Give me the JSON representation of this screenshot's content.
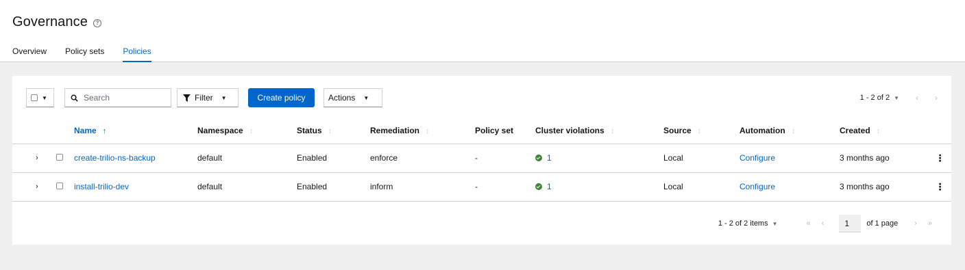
{
  "header": {
    "title": "Governance",
    "help_icon": "help-icon",
    "tabs": [
      {
        "label": "Overview",
        "active": false
      },
      {
        "label": "Policy sets",
        "active": false
      },
      {
        "label": "Policies",
        "active": true
      }
    ]
  },
  "toolbar": {
    "search_placeholder": "Search",
    "filter_label": "Filter",
    "create_label": "Create policy",
    "actions_label": "Actions",
    "pagination_label": "1 - 2 of 2"
  },
  "table": {
    "columns": [
      "Name",
      "Namespace",
      "Status",
      "Remediation",
      "Policy set",
      "Cluster violations",
      "Source",
      "Automation",
      "Created"
    ],
    "rows": [
      {
        "name": "create-trilio-ns-backup",
        "namespace": "default",
        "status": "Enabled",
        "remediation": "enforce",
        "policy_set": "-",
        "cluster_violations": "1",
        "source": "Local",
        "automation": "Configure",
        "created": "3 months ago"
      },
      {
        "name": "install-trilio-dev",
        "namespace": "default",
        "status": "Enabled",
        "remediation": "inform",
        "policy_set": "-",
        "cluster_violations": "1",
        "source": "Local",
        "automation": "Configure",
        "created": "3 months ago"
      }
    ]
  },
  "pagination": {
    "items_label": "1 - 2 of 2 items",
    "page": "1",
    "of_pages": "of 1 page"
  },
  "colors": {
    "accent": "#0066cc",
    "success": "#3e8635",
    "background": "#f0f0f0"
  }
}
